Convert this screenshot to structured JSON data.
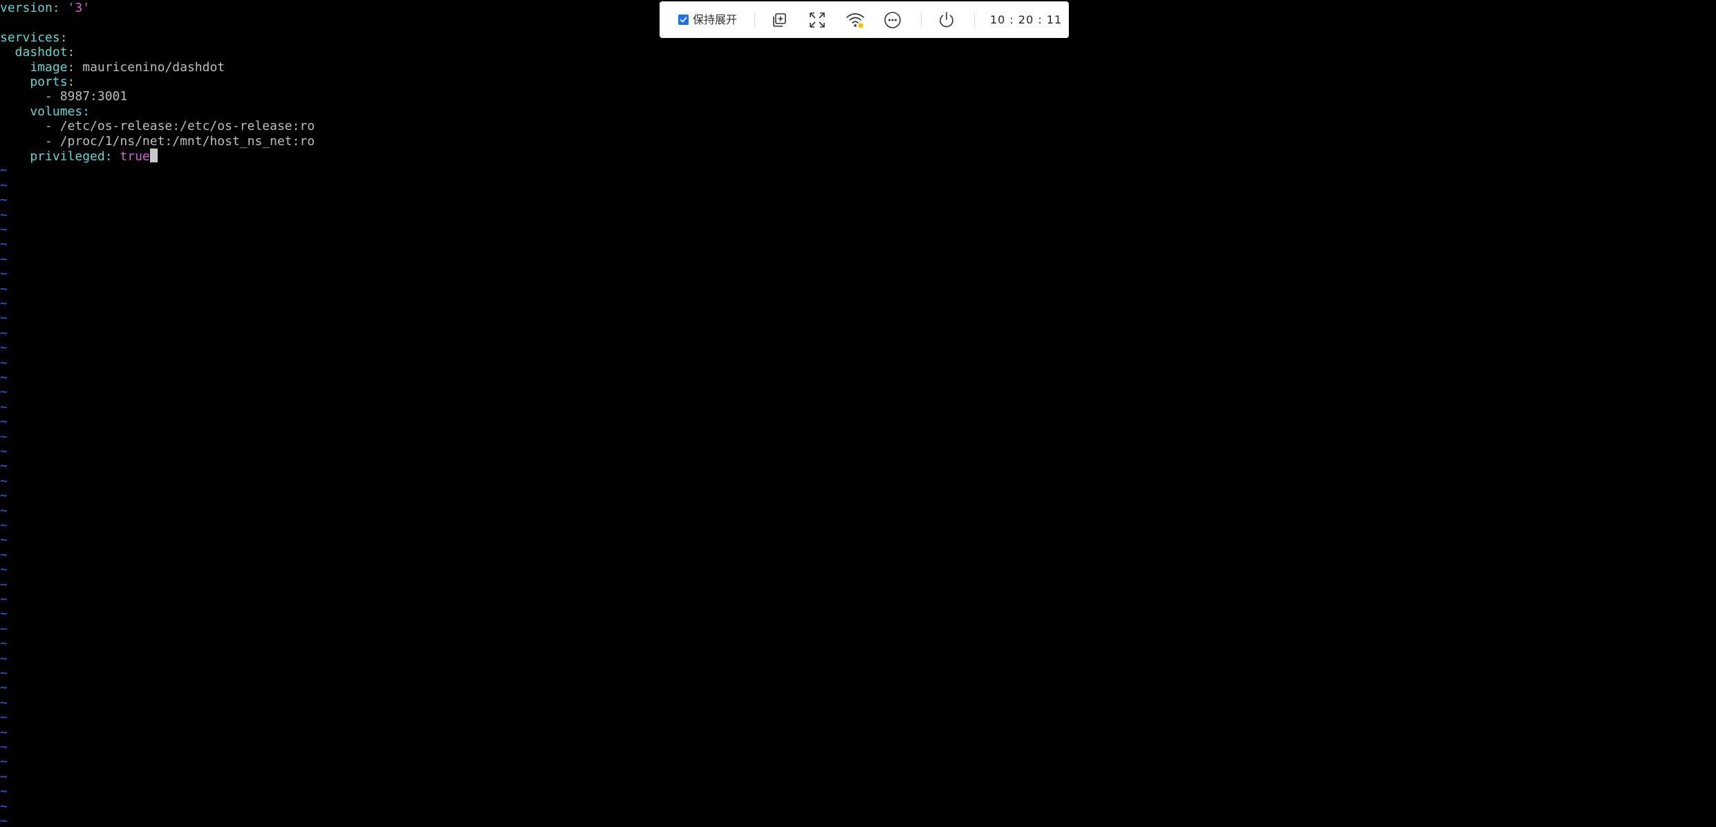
{
  "editor": {
    "lines": [
      [
        {
          "t": "version",
          "c": "key"
        },
        {
          "t": ": ",
          "c": "punct"
        },
        {
          "t": "'3'",
          "c": "str"
        }
      ],
      [],
      [
        {
          "t": "services",
          "c": "key"
        },
        {
          "t": ":",
          "c": "punct"
        }
      ],
      [
        {
          "t": "  dashdot",
          "c": "key"
        },
        {
          "t": ":",
          "c": "punct"
        }
      ],
      [
        {
          "t": "    image",
          "c": "key"
        },
        {
          "t": ": ",
          "c": "punct"
        },
        {
          "t": "mauricenino/dashdot",
          "c": "plain"
        }
      ],
      [
        {
          "t": "    ports",
          "c": "key"
        },
        {
          "t": ":",
          "c": "punct"
        }
      ],
      [
        {
          "t": "      - 8987:3001",
          "c": "plain"
        }
      ],
      [
        {
          "t": "    volumes",
          "c": "key"
        },
        {
          "t": ":",
          "c": "punct"
        }
      ],
      [
        {
          "t": "      - /etc/os-release:/etc/os-release:ro",
          "c": "plain"
        }
      ],
      [
        {
          "t": "      - /proc/1/ns/net:/mnt/host_ns_net:ro",
          "c": "plain"
        }
      ],
      [
        {
          "t": "    privileged",
          "c": "key"
        },
        {
          "t": ": ",
          "c": "punct"
        },
        {
          "t": "true",
          "c": "bool"
        }
      ]
    ],
    "cursor_line": 10,
    "empty_line_marker": "~",
    "empty_line_count": 45
  },
  "toolbar": {
    "keep_expanded_checked": true,
    "keep_expanded_label": "保持展开",
    "time": "10 : 20 : 11",
    "icons": [
      "copy-add-icon",
      "fullscreen-icon",
      "wifi-icon",
      "more-icon",
      "power-icon"
    ]
  },
  "colors": {
    "background": "#000000",
    "yaml_key": "#5fd7d7",
    "yaml_string": "#d75fd7",
    "plain_text": "#bdbdbd",
    "tilde": "#3a5dff",
    "checkbox": "#1e6fe8",
    "wifi_status": "#f5c400"
  }
}
